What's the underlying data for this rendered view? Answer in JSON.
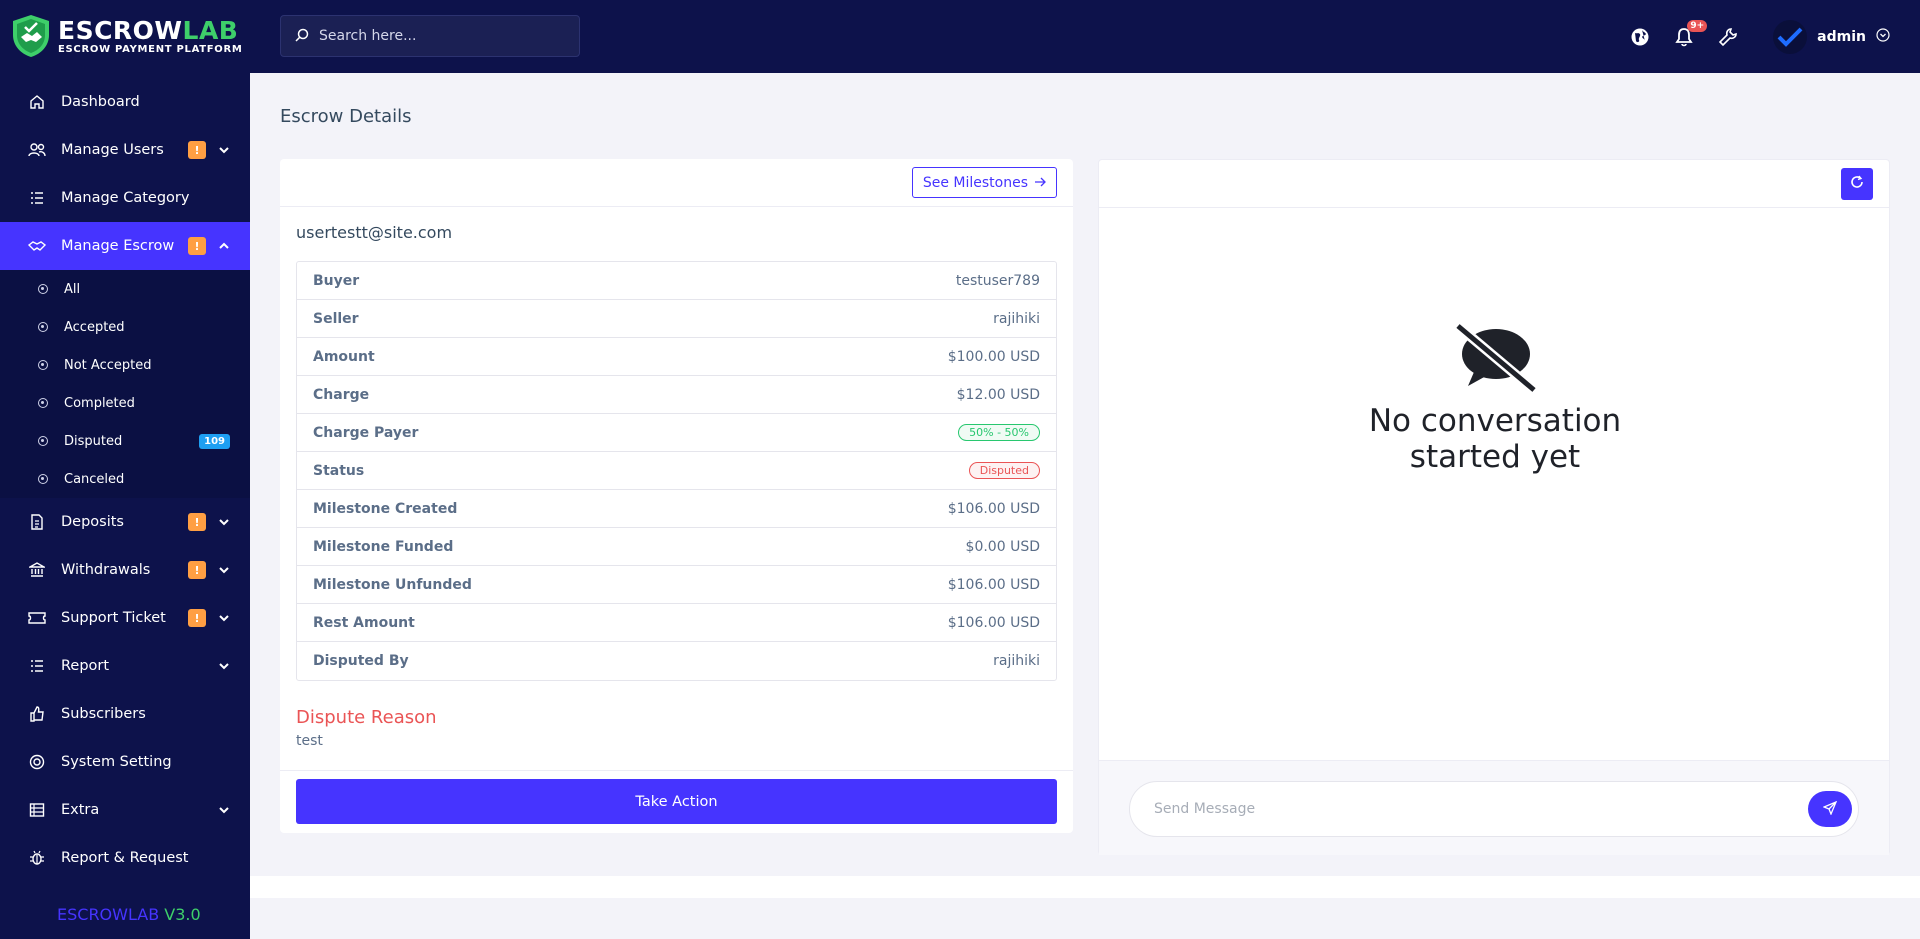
{
  "brand": {
    "name_a": "ESCROW",
    "name_b": "LAB",
    "tagline": "ESCROW PAYMENT PLATFORM",
    "version_name": "ESCROWLAB",
    "version_num": "V3.0"
  },
  "search": {
    "placeholder": "Search here..."
  },
  "topbar": {
    "notif_count": "9+",
    "user_name": "admin"
  },
  "sidebar": {
    "items": [
      {
        "label": "Dashboard",
        "icon": "home-icon"
      },
      {
        "label": "Manage Users",
        "icon": "users-icon",
        "badge": "!"
      },
      {
        "label": "Manage Category",
        "icon": "list-icon"
      },
      {
        "label": "Manage Escrow",
        "icon": "handshake-icon",
        "badge": "!"
      },
      {
        "label": "Deposits",
        "icon": "file-dollar-icon",
        "badge": "!"
      },
      {
        "label": "Withdrawals",
        "icon": "bank-icon",
        "badge": "!"
      },
      {
        "label": "Support Ticket",
        "icon": "ticket-icon",
        "badge": "!"
      },
      {
        "label": "Report",
        "icon": "list-icon"
      },
      {
        "label": "Subscribers",
        "icon": "thumbs-up-icon"
      },
      {
        "label": "System Setting",
        "icon": "lifebuoy-icon"
      },
      {
        "label": "Extra",
        "icon": "server-icon"
      },
      {
        "label": "Report & Request",
        "icon": "bug-icon"
      }
    ],
    "escrow_sub": [
      {
        "label": "All"
      },
      {
        "label": "Accepted"
      },
      {
        "label": "Not Accepted"
      },
      {
        "label": "Completed"
      },
      {
        "label": "Disputed",
        "count": "109"
      },
      {
        "label": "Canceled"
      }
    ]
  },
  "page": {
    "title": "Escrow Details"
  },
  "escrow": {
    "see_milestones": "See Milestones",
    "email": "usertestt@site.com",
    "rows": [
      {
        "label": "Buyer",
        "value": "testuser789"
      },
      {
        "label": "Seller",
        "value": "rajihiki"
      },
      {
        "label": "Amount",
        "value": "$100.00 USD"
      },
      {
        "label": "Charge",
        "value": "$12.00 USD"
      },
      {
        "label": "Charge Payer",
        "value": "50% - 50%"
      },
      {
        "label": "Status",
        "value": "Disputed"
      },
      {
        "label": "Milestone Created",
        "value": "$106.00 USD"
      },
      {
        "label": "Milestone Funded",
        "value": "$0.00 USD"
      },
      {
        "label": "Milestone Unfunded",
        "value": "$106.00 USD"
      },
      {
        "label": "Rest Amount",
        "value": "$106.00 USD"
      },
      {
        "label": "Disputed By",
        "value": "rajihiki"
      }
    ],
    "dispute_title": "Dispute Reason",
    "dispute_text": "test",
    "action_label": "Take Action"
  },
  "chat": {
    "empty_line1": "No conversation",
    "empty_line2": "started yet",
    "message_placeholder": "Send Message"
  },
  "colors": {
    "primary": "#4634ff",
    "sidebar": "#0d124b",
    "green": "#3ecf6a",
    "warn": "#ff9f43",
    "danger": "#ea5455"
  }
}
